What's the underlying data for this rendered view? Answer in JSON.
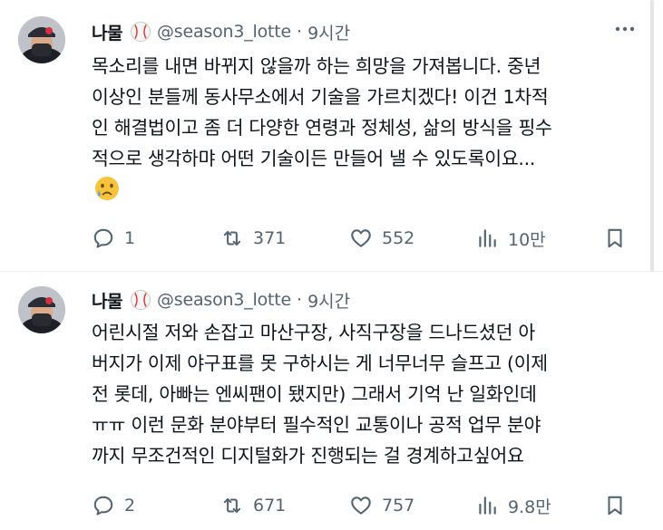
{
  "tweets": [
    {
      "author_name": "나물",
      "handle": "@season3_lotte",
      "separator": "·",
      "time": "9시간",
      "lines": [
        "목소리를 내면 바뀌지 않을까 하는 희망을 가져봅니다. 중년",
        "이상인 분들께  동사무소에서 기술을 가르치겠다! 이건 1차적",
        "인 해결법이고 좀 더 다양한 연령과 정체성, 삶의 방식을 핑수",
        "적으로 생각하먀 어떤 기술이든 만들어 낼 수 있도록이요..."
      ],
      "emoji": "crying-face-emoji",
      "replies": "1",
      "retweets": "371",
      "likes": "552",
      "views": "10만"
    },
    {
      "author_name": "나물",
      "handle": "@season3_lotte",
      "separator": "·",
      "time": "9시간",
      "lines": [
        "어린시절 저와 손잡고 마산구장, 사직구장을 드나드셨던 아",
        "버지가 이제 야구표를 못 구하시는 게 너무너무 슬프고 (이제",
        "전 롯데, 아빠는 엔씨팬이 됐지만) 그래서 기억 난 일화인데",
        "ㅠㅠ 이런 문화 분야부터 필수적인 교통이나 공적 업무 분야",
        "까지 무조건적인 디지털화가 진행되는 걸 경계하고싶어요"
      ],
      "replies": "2",
      "retweets": "671",
      "likes": "757",
      "views": "9.8만"
    }
  ],
  "colors": {
    "text": "#0f1419",
    "secondary": "#536471",
    "divider": "#eff3f4"
  }
}
